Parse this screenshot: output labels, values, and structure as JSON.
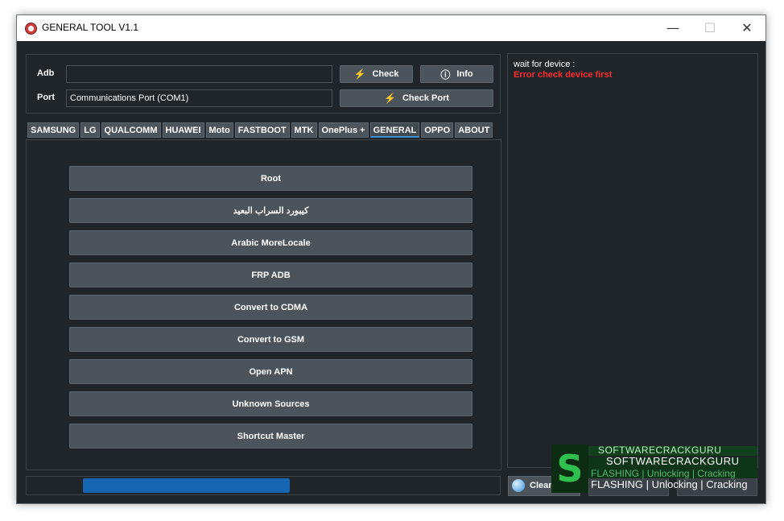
{
  "window": {
    "title": "GENERAL TOOL V1.1",
    "controls": {
      "minimize": "—",
      "maximize": "☐",
      "close": "✕"
    }
  },
  "connection": {
    "adb_label": "Adb",
    "adb_value": "",
    "port_label": "Port",
    "port_value": "Communications Port (COM1)",
    "check_label": "Check",
    "info_label": "Info",
    "check_port_label": "Check Port"
  },
  "tabs": [
    "SAMSUNG",
    "LG",
    "QUALCOMM",
    "HUAWEI",
    "Moto",
    "FASTBOOT",
    "MTK",
    "OnePlus +",
    "GENERAL",
    "OPPO",
    "ABOUT"
  ],
  "active_tab": "GENERAL",
  "actions": [
    "Root",
    "كيبورد السراب البعيد",
    "Arabic MoreLocale",
    "FRP ADB",
    "Convert to CDMA",
    "Convert to GSM",
    "Open APN",
    "Unknown Sources",
    "Shortcut Master"
  ],
  "log": {
    "line1": "wait for device :",
    "line2": "Error check device first"
  },
  "progress": {
    "percent": 50
  },
  "footer": {
    "clear_label": "Clear Logs"
  },
  "watermark": {
    "logo_letter": "S",
    "line1": "SOFTWARECRACKGURU",
    "line2": "SOFTWARECRACKGURU",
    "line3": "FLASHING | Unlocking | Cracking",
    "line4": "FLASHING | Unlocking | Cracking"
  },
  "colors": {
    "background": "#1f2529",
    "button": "#4b545a",
    "error": "#ff2a2a",
    "progress": "#1565b0",
    "active_tab_accent": "#3c8fd1"
  }
}
